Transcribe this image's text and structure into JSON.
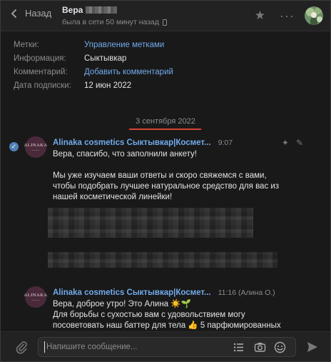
{
  "header": {
    "back_label": "Назад",
    "name": "Вера",
    "status": "была в сети 50 минут назад"
  },
  "info": {
    "rows": [
      {
        "label": "Метки:",
        "value": "Управление метками"
      },
      {
        "label": "Информация:",
        "value": "Сыктывкар"
      },
      {
        "label": "Комментарий:",
        "value": "Добавить комментарий"
      },
      {
        "label": "Дата подписки:",
        "value": "12 июн 2022"
      }
    ]
  },
  "date_divider": "3 сентября 2022",
  "messages": [
    {
      "author": "Alinaka cosmetics Сыктывкар|Космет...",
      "time": "9:07",
      "avatar_text": "ALINAKA",
      "lines": [
        "Вера, спасибо, что заполнили анкету!",
        "Мы уже изучаем ваши ответы и скоро свяжемся с вами,",
        "чтобы подобрать лучшее натуральное средство для вас из",
        "нашей косметической линейки!"
      ]
    },
    {
      "author": "Alinaka cosmetics Сыктывкар|Космет...",
      "time": "11:16 (Алина О.)",
      "avatar_text": "ALINAKA",
      "lines": [
        "Вера, доброе утро! Это Алина ☀️🌱",
        "Для борьбы с сухостью вам с удовольствием могу",
        "посоветовать наш баттер для тела 👍 5 парфюмированных"
      ]
    }
  ],
  "composer": {
    "placeholder": "Напишите сообщение..."
  },
  "colors": {
    "accent": "#71aaeb",
    "background": "#191919",
    "header": "#222222",
    "date_underline": "#d64533"
  }
}
